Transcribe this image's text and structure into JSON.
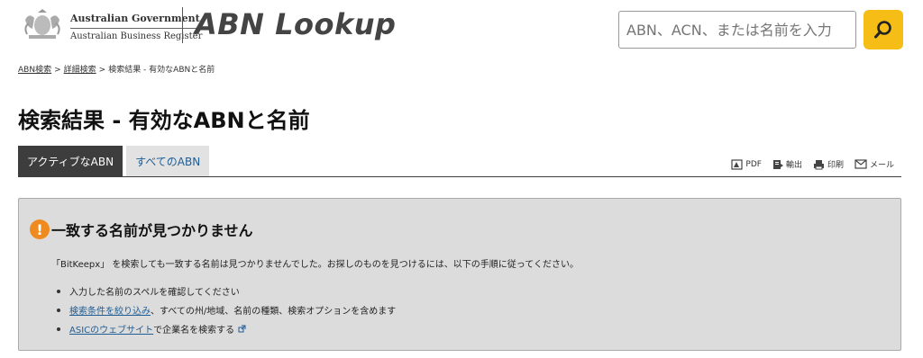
{
  "header": {
    "gov_line1": "Australian Government",
    "gov_line2": "Australian Business Register",
    "app_title": "ABN Lookup",
    "search_placeholder": "ABN、ACN、または名前を入力",
    "search_icon": "search-icon",
    "accent_color": "#f5bd16"
  },
  "breadcrumb": {
    "items": [
      "ABN検索",
      "詳細検索",
      "検索結果 - 有効なABNと名前"
    ],
    "separator": ">"
  },
  "page": {
    "title": "検索結果 - 有効なABNと名前"
  },
  "tabs": [
    {
      "label": "アクティブなABN",
      "active": true
    },
    {
      "label": "すべてのABN",
      "active": false
    }
  ],
  "actions": [
    {
      "label": "PDF",
      "icon": "pdf-icon"
    },
    {
      "label": "輸出",
      "icon": "export-icon"
    },
    {
      "label": "印刷",
      "icon": "print-icon"
    },
    {
      "label": "メール",
      "icon": "mail-icon"
    }
  ],
  "message": {
    "icon": "warning-icon",
    "title": "一致する名前が見つかりません",
    "description": "「BitKeepx」 を検索しても一致する名前は見つかりませんでした。お探しのものを見つけるには、以下の手順に従ってください。",
    "items": [
      {
        "text": "入力した名前のスペルを確認してください"
      },
      {
        "link": "検索条件を絞り込み",
        "text": "、すべての州/地域、名前の種類、検索オプションを含めます"
      },
      {
        "link": "ASICのウェブサイト",
        "text": "で企業名を検索する"
      }
    ]
  }
}
